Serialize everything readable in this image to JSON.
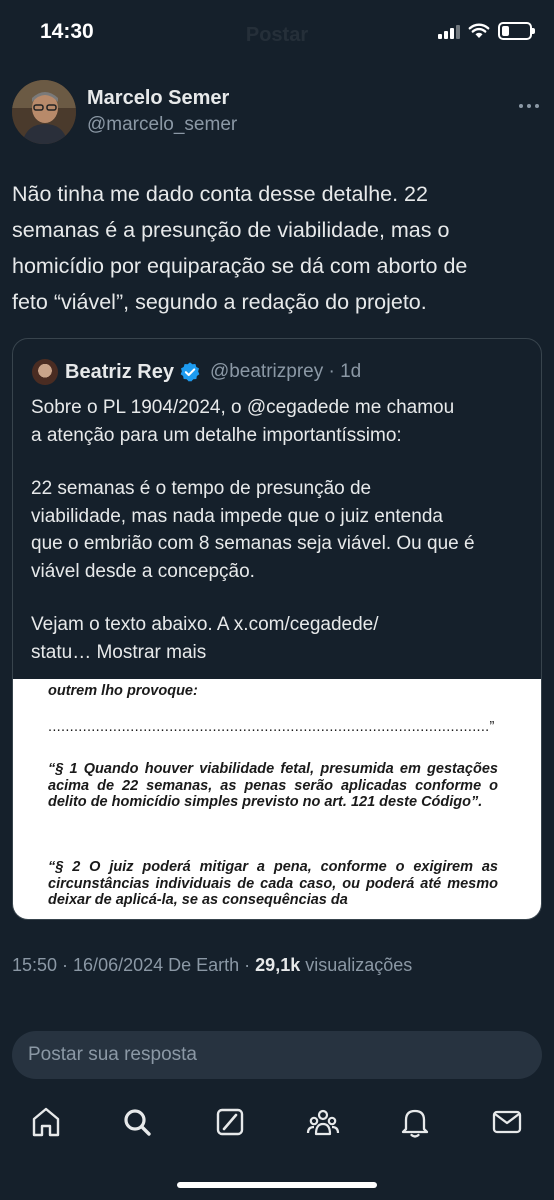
{
  "status_bar": {
    "time": "14:30",
    "ghost_title": "Postar",
    "battery_level": 0.25
  },
  "post": {
    "author_name": "Marcelo Semer",
    "author_handle": "@marcelo_semer",
    "more_icon": "more-horizontal-icon",
    "text_lines": [
      "Não tinha me dado conta desse detalhe. 22",
      "semanas é a presunção de viabilidade, mas o",
      "homicídio por equiparação se dá com aborto de",
      "feto “viável”, segundo a redação do projeto."
    ]
  },
  "quote": {
    "name": "Beatriz Rey",
    "handle_time": "@beatrizprey · 1d",
    "verified_color": "#1d9bf0",
    "lines": [
      "Sobre o PL 1904/2024, o @cegadede me chamou",
      "a atenção para um detalhe importantíssimo:",
      "",
      "22 semanas é o tempo de presunção de",
      "viabilidade, mas nada impede que o juiz entenda",
      "que o embrião com 8 semanas seja viável. Ou que é",
      "viável desde a concepção.",
      "",
      "Vejam o texto abaixo. A x.com/cegadede/"
    ],
    "last_line_prefix": "statu… ",
    "show_more": "Mostrar mais",
    "image": {
      "line_top": "outrem lho provoque:",
      "dots_line": "......................................................................................................”",
      "para1": "“§ 1 Quando houver viabilidade fetal, presumida em gestações acima de 22 semanas, as penas serão aplicadas conforme o delito de homicídio simples previsto no art. 121 deste Código”.",
      "para2": "“§ 2 O juiz poderá mitigar a pena, conforme o exigirem as circunstâncias individuais de cada caso, ou poderá até mesmo deixar de aplicá-la, se as consequências da"
    }
  },
  "meta": {
    "time_date_source": "15:50 · 16/06/2024 De Earth · ",
    "views_count": "29,1k",
    "views_label": " visualizações"
  },
  "reply": {
    "placeholder": "Postar sua resposta"
  },
  "tabs": [
    {
      "icon": "home-icon"
    },
    {
      "icon": "search-icon"
    },
    {
      "icon": "grok-icon"
    },
    {
      "icon": "communities-icon"
    },
    {
      "icon": "notifications-icon"
    },
    {
      "icon": "messages-icon"
    }
  ],
  "colors": {
    "background": "#15202b",
    "text": "#e7e9ea",
    "secondary": "#8b98a5",
    "border": "#38444d",
    "accent": "#1d9bf0"
  }
}
